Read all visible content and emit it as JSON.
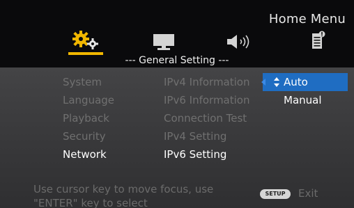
{
  "header": {
    "title": "Home Menu",
    "tabs": [
      {
        "icon": "gear-icon",
        "name": "General Setting",
        "active": true
      },
      {
        "icon": "monitor-icon"
      },
      {
        "icon": "speaker-icon"
      },
      {
        "icon": "document-icon"
      }
    ],
    "section_title": "--- General Setting ---"
  },
  "menu": {
    "left_items": [
      "System",
      "Language",
      "Playback",
      "Security",
      "Network"
    ],
    "left_active": "Network",
    "mid_items": [
      "IPv4 Information",
      "IPv6 Information",
      "Connection Test",
      "IPv4 Setting",
      "IPv6 Setting"
    ],
    "mid_active": "IPv6 Setting",
    "options": [
      "Auto",
      "Manual"
    ],
    "selected_option": "Auto"
  },
  "footer": {
    "hint_line1": "Use cursor key to move focus, use",
    "hint_line2": "\"ENTER\" key to select",
    "setup_button": "SETUP",
    "exit_label": "Exit"
  },
  "colors": {
    "accent": "#f1b700",
    "selection": "#1f6dc2",
    "active_text": "#ffffff",
    "inactive_text": "#707070"
  }
}
